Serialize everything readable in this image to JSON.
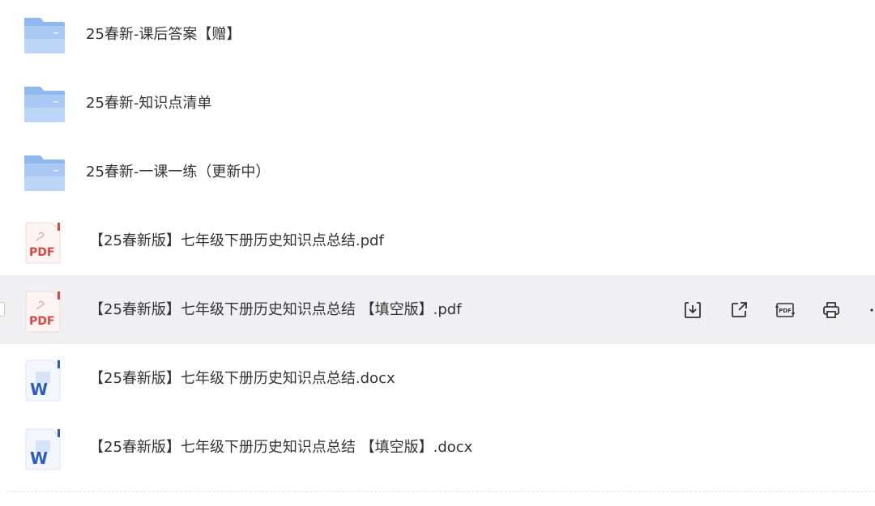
{
  "files": [
    {
      "type": "folder",
      "name": "25春新-课后答案【赠】"
    },
    {
      "type": "folder",
      "name": "25春新-知识点清单"
    },
    {
      "type": "folder",
      "name": "25春新-一课一练（更新中）"
    },
    {
      "type": "pdf",
      "name": "【25春新版】七年级下册历史知识点总结.pdf",
      "badge": "PDF"
    },
    {
      "type": "pdf",
      "name": "【25春新版】七年级下册历史知识点总结 【填空版】.pdf",
      "badge": "PDF"
    },
    {
      "type": "docx",
      "name": "【25春新版】七年级下册历史知识点总结.docx",
      "badge": "W"
    },
    {
      "type": "docx",
      "name": "【25春新版】七年级下册历史知识点总结 【填空版】.docx",
      "badge": "W"
    }
  ],
  "row_actions": [
    {
      "icon": "download-icon"
    },
    {
      "icon": "share-icon"
    },
    {
      "icon": "convert-pdf-icon",
      "label": "PDF"
    },
    {
      "icon": "print-icon"
    },
    {
      "icon": "more-icon"
    }
  ],
  "colors": {
    "folder": "#8fb8ef",
    "folder_light": "#bcd6f7",
    "pdf_red": "#e0463e",
    "word_blue": "#2d5cc8",
    "highlight": "#f0f0f2"
  }
}
